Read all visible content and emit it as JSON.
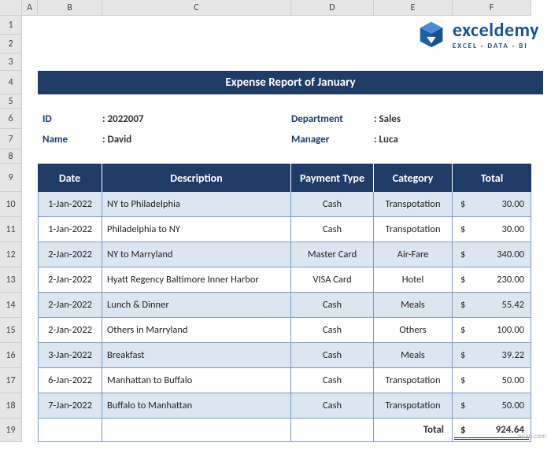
{
  "columns": [
    "A",
    "B",
    "C",
    "D",
    "E",
    "F"
  ],
  "rows": [
    "1",
    "2",
    "3",
    "4",
    "5",
    "6",
    "7",
    "8",
    "9",
    "10",
    "11",
    "12",
    "13",
    "14",
    "15",
    "16",
    "17",
    "18",
    "19"
  ],
  "logo": {
    "main": "exceldemy",
    "sub": "EXCEL · DATA · BI"
  },
  "titleBar": "Expense Report of January",
  "info": {
    "id_label": "ID",
    "id_value": ": 2022007",
    "name_label": "Name",
    "name_value": ": David",
    "dept_label": "Department",
    "dept_value": ": Sales",
    "mgr_label": "Manager",
    "mgr_value": ": Luca"
  },
  "headers": {
    "date": "Date",
    "desc": "Description",
    "pay": "Payment Type",
    "cat": "Category",
    "total": "Total"
  },
  "rows_data": [
    {
      "date": "1-Jan-2022",
      "desc": "NY to Philadelphia",
      "pay": "Cash",
      "cat": "Transpotation",
      "total": "30.00"
    },
    {
      "date": "1-Jan-2022",
      "desc": "Philadelphia to NY",
      "pay": "Cash",
      "cat": "Transpotation",
      "total": "30.00"
    },
    {
      "date": "2-Jan-2022",
      "desc": "NY to Marryland",
      "pay": "Master Card",
      "cat": "Air-Fare",
      "total": "340.00"
    },
    {
      "date": "2-Jan-2022",
      "desc": "Hyatt Regency Baltimore Inner Harbor",
      "pay": "VISA Card",
      "cat": "Hotel",
      "total": "230.00"
    },
    {
      "date": "2-Jan-2022",
      "desc": "Lunch & Dinner",
      "pay": "Cash",
      "cat": "Meals",
      "total": "55.42"
    },
    {
      "date": "2-Jan-2022",
      "desc": "Others in Marryland",
      "pay": "Cash",
      "cat": "Others",
      "total": "100.00"
    },
    {
      "date": "3-Jan-2022",
      "desc": "Breakfast",
      "pay": "Cash",
      "cat": "Meals",
      "total": "39.22"
    },
    {
      "date": "6-Jan-2022",
      "desc": "Manhattan to Buffalo",
      "pay": "Cash",
      "cat": "Transpotation",
      "total": "50.00"
    },
    {
      "date": "7-Jan-2022",
      "desc": "Buffalo to Manhattan",
      "pay": "Cash",
      "cat": "Transpotation",
      "total": "50.00"
    }
  ],
  "total": {
    "label": "Total",
    "value": "924.64",
    "currency": "$"
  },
  "watermark": "wsxn.com"
}
